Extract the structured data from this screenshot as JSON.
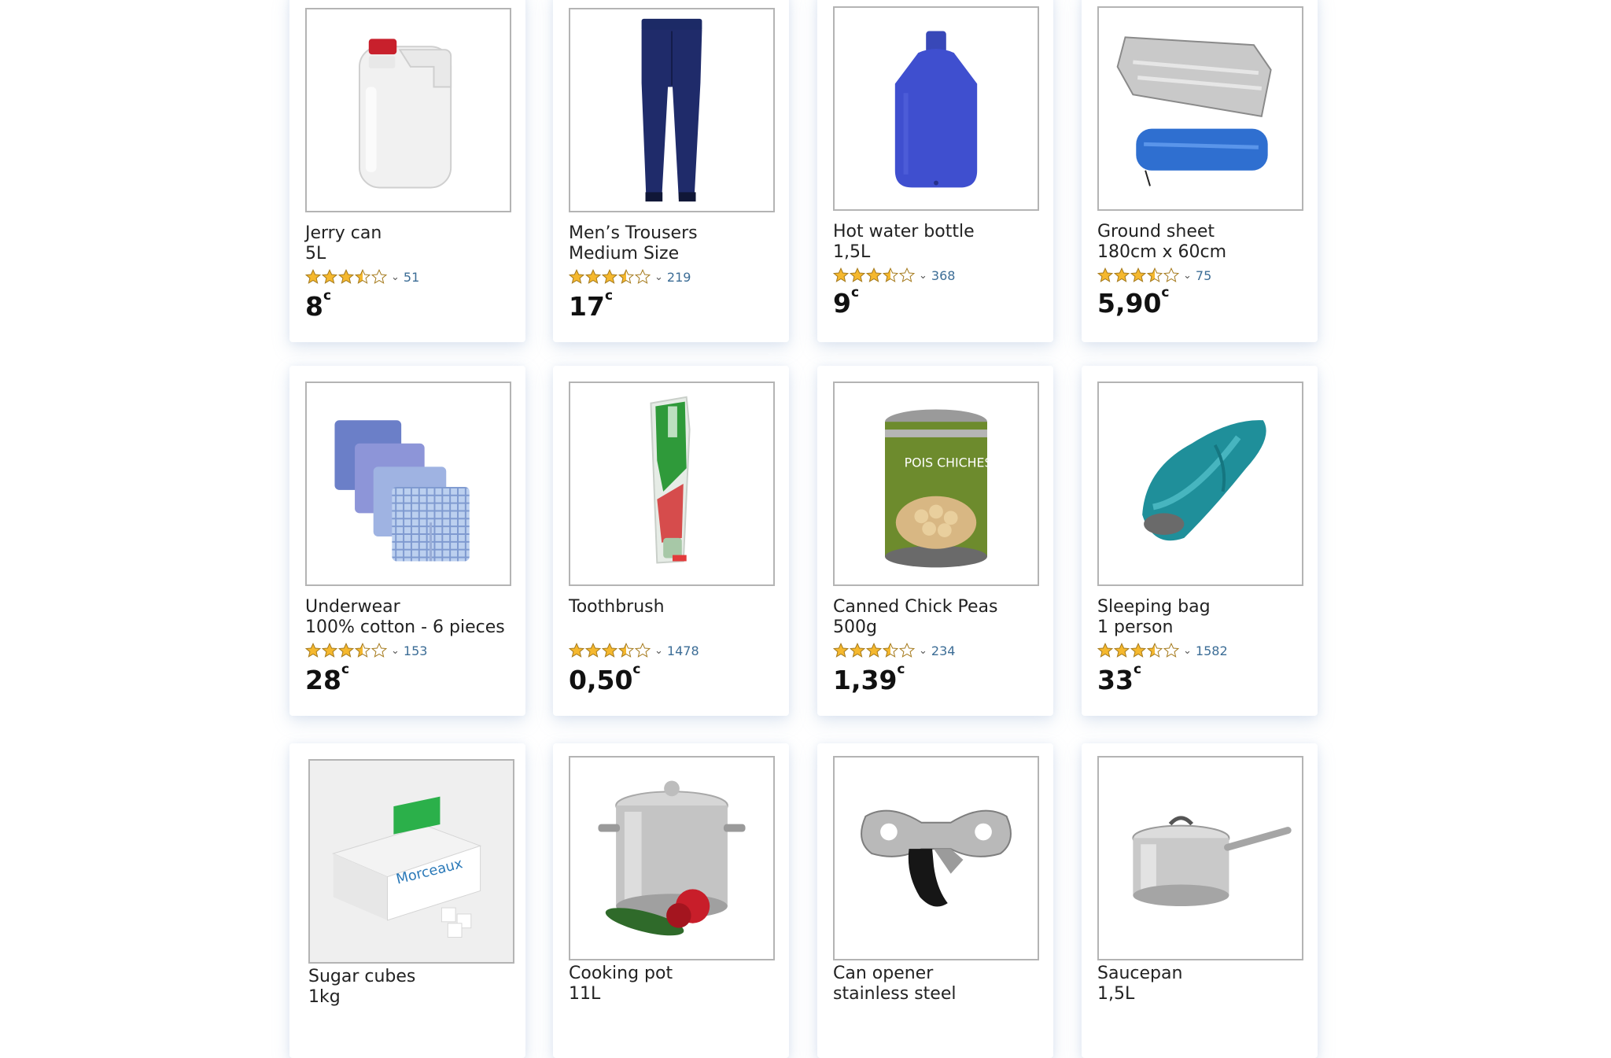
{
  "colors": {
    "star_fill": "#f5b82e",
    "star_stroke": "#a57a1c",
    "count_text": "#3c6d96"
  },
  "products": [
    {
      "title": "Jerry can\n5L",
      "rating": 3.5,
      "reviews": "51",
      "price": "8",
      "currency": "c",
      "icon": "jerry-can-icon"
    },
    {
      "title": "Men’s Trousers\nMedium Size",
      "rating": 3.5,
      "reviews": "219",
      "price": "17",
      "currency": "c",
      "icon": "trousers-icon"
    },
    {
      "title": "Hot water bottle\n1,5L",
      "rating": 3.5,
      "reviews": "368",
      "price": "9",
      "currency": "c",
      "icon": "hot-water-bottle-icon"
    },
    {
      "title": "Ground sheet\n180cm x 60cm",
      "rating": 3.5,
      "reviews": "75",
      "price": "5,90",
      "currency": "c",
      "icon": "ground-sheet-icon"
    },
    {
      "title": "Underwear\n100% cotton - 6 pieces",
      "rating": 3.5,
      "reviews": "153",
      "price": "28",
      "currency": "c",
      "icon": "underwear-icon"
    },
    {
      "title": "Toothbrush",
      "rating": 3.5,
      "reviews": "1478",
      "price": "0,50",
      "currency": "c",
      "icon": "toothbrush-icon"
    },
    {
      "title": "Canned Chick Peas\n500g",
      "rating": 3.5,
      "reviews": "234",
      "price": "1,39",
      "currency": "c",
      "icon": "canned-chickpeas-icon",
      "label_text": "POIS CHICHES"
    },
    {
      "title": "Sleeping bag\n1 person",
      "rating": 3.5,
      "reviews": "1582",
      "price": "33",
      "currency": "c",
      "icon": "sleeping-bag-icon"
    },
    {
      "title": "Sugar cubes\n1kg",
      "icon": "sugar-cubes-icon",
      "label_text": "Morceaux"
    },
    {
      "title": "Cooking pot\n11L",
      "icon": "cooking-pot-icon"
    },
    {
      "title": "Can opener\nstainless steel",
      "icon": "can-opener-icon"
    },
    {
      "title": "Saucepan\n1,5L",
      "icon": "saucepan-icon"
    }
  ]
}
